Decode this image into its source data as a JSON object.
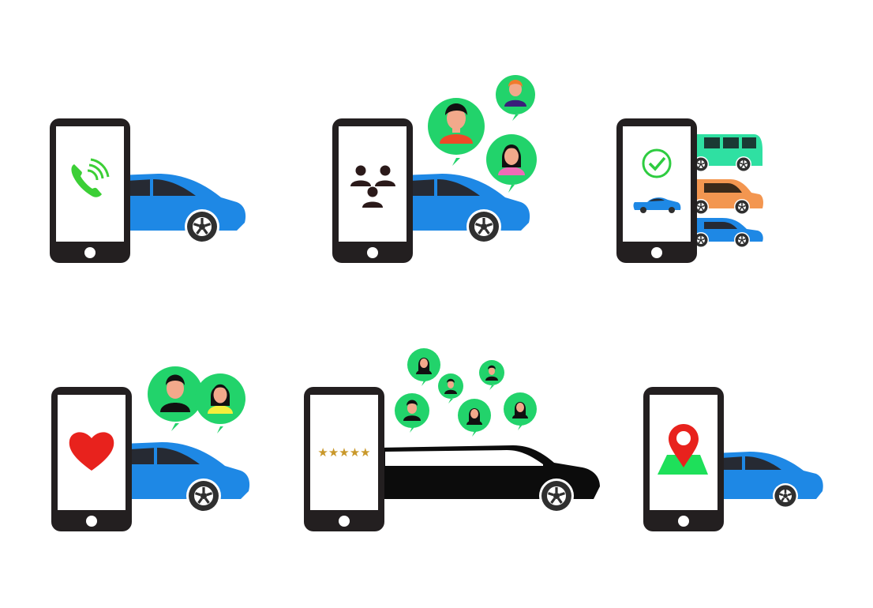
{
  "palette": {
    "phone_body": "#231f20",
    "screen": "#ffffff",
    "car_blue": "#1e88e5",
    "car_window": "#262a33",
    "wheel": "#2f2f2f",
    "bubble_green": "#22d36b",
    "call_green": "#3ccf36",
    "check_green": "#2ecc40",
    "heart_red": "#e8221d",
    "pin_red": "#e8221d",
    "map_green": "#1ee05a",
    "star_gold": "#c9982a",
    "bus_teal": "#2fe0a2",
    "van_orange": "#f39650",
    "limo_black": "#0c0c0c"
  },
  "panels": [
    {
      "name": "call-a-cab",
      "screen_icon": "phone-call-icon",
      "vehicle": "car"
    },
    {
      "name": "ride-share",
      "screen_icon": "group-icon",
      "vehicle": "car",
      "bubbles": 3
    },
    {
      "name": "choose-vehicle",
      "screen_icon": "check-icon",
      "vehicle": "fleet"
    },
    {
      "name": "favorite-drivers",
      "screen_icon": "heart-icon",
      "vehicle": "car",
      "bubbles": 2
    },
    {
      "name": "rate-limo",
      "screen_icon": "star-rating-icon",
      "vehicle": "limousine",
      "bubbles": 6
    },
    {
      "name": "map-location",
      "screen_icon": "map-pin-icon",
      "vehicle": "car"
    }
  ],
  "rating": {
    "stars": "★★★★★",
    "value": 5
  }
}
